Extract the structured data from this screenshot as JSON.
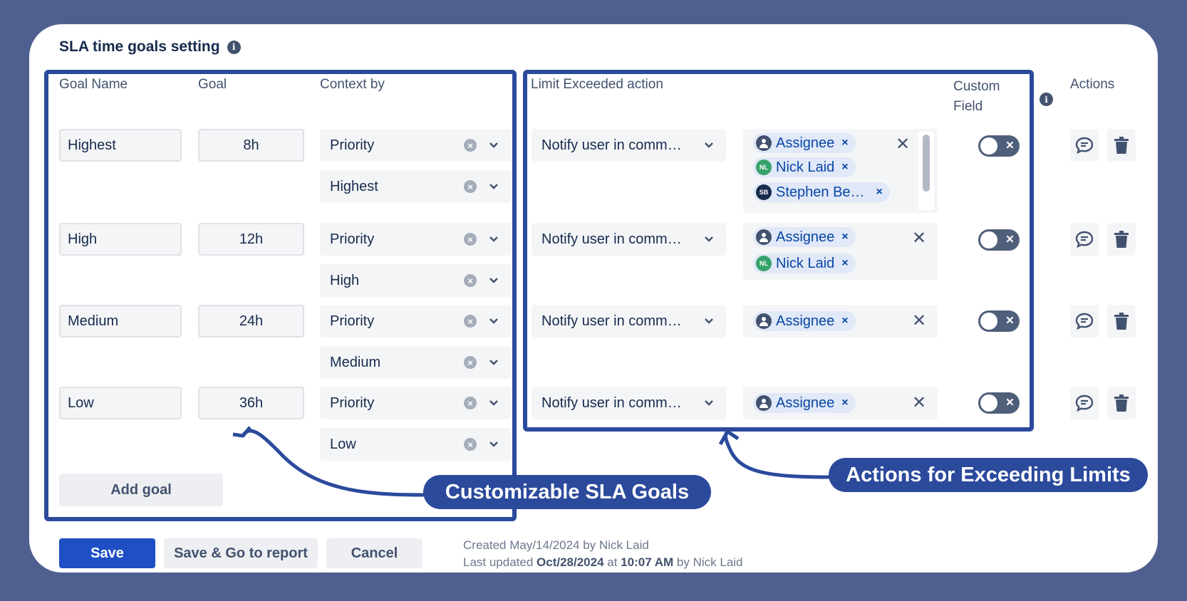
{
  "title": "SLA time goals setting",
  "headers": {
    "goal_name": "Goal Name",
    "goal": "Goal",
    "context_by": "Context by",
    "limit_action": "Limit Exceeded action",
    "custom_field_1": "Custom",
    "custom_field_2": "Field",
    "actions": "Actions"
  },
  "rows": [
    {
      "name": "Highest",
      "goal": "8h",
      "context_field": "Priority",
      "context_value": "Highest",
      "action": "Notify user in comm…",
      "recipients": [
        "Assignee",
        "Nick Laid",
        "Stephen Be…"
      ]
    },
    {
      "name": "High",
      "goal": "12h",
      "context_field": "Priority",
      "context_value": "High",
      "action": "Notify user in comm…",
      "recipients": [
        "Assignee",
        "Nick Laid"
      ]
    },
    {
      "name": "Medium",
      "goal": "24h",
      "context_field": "Priority",
      "context_value": "Medium",
      "action": "Notify user in comm…",
      "recipients": [
        "Assignee"
      ]
    },
    {
      "name": "Low",
      "goal": "36h",
      "context_field": "Priority",
      "context_value": "Low",
      "action": "Notify user in comm…",
      "recipients": [
        "Assignee"
      ]
    }
  ],
  "avatars": {
    "nick": "NL",
    "stephen": "SB"
  },
  "add_goal": "Add goal",
  "buttons": {
    "save": "Save",
    "save_go": "Save & Go to report",
    "cancel": "Cancel"
  },
  "meta": {
    "created": "Created May/14/2024 by Nick Laid",
    "updated_prefix": "Last updated ",
    "updated_date": "Oct/28/2024",
    "updated_at": " at ",
    "updated_time": "10:07 AM",
    "updated_suffix": " by Nick Laid"
  },
  "callouts": {
    "goals": "Customizable SLA Goals",
    "actions": "Actions for Exceeding Limits"
  },
  "colors": {
    "background": "#4F6090",
    "highlight": "#2B4A9C",
    "primary": "#1E4FC4",
    "chip": "#E1E8F7",
    "nick_avatar": "#36A36B"
  }
}
